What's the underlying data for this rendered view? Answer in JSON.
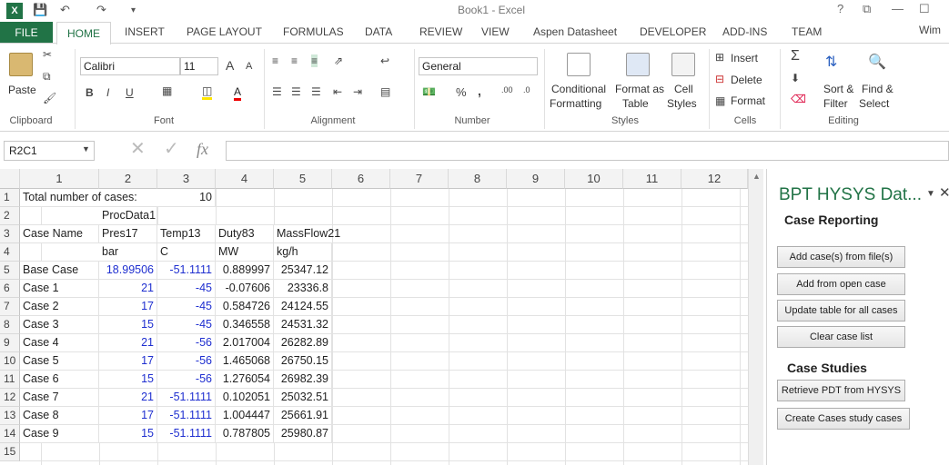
{
  "titlebar": {
    "title": "Book1 - Excel",
    "help": "?",
    "restore": "⧉",
    "minimize": "—",
    "maximize": "☐"
  },
  "tabs": {
    "file": "FILE",
    "home": "HOME",
    "items": [
      "INSERT",
      "PAGE LAYOUT",
      "FORMULAS",
      "DATA",
      "REVIEW",
      "VIEW",
      "Aspen Datasheet",
      "DEVELOPER",
      "ADD-INS",
      "TEAM"
    ],
    "user": "Wim"
  },
  "ribbon": {
    "clipboard": {
      "paste": "Paste",
      "label": "Clipboard"
    },
    "font": {
      "name": "Calibri",
      "size": "11",
      "bold": "B",
      "italic": "I",
      "underline": "U",
      "grow": "A",
      "shrink": "A",
      "color": "A",
      "label": "Font"
    },
    "alignment": {
      "label": "Alignment"
    },
    "number": {
      "format": "General",
      "percent": "%",
      "comma": ",",
      "label": "Number"
    },
    "styles": {
      "conditional": "Conditional",
      "conditional2": "Formatting",
      "table": "Format as",
      "table2": "Table",
      "cell": "Cell",
      "cell2": "Styles",
      "label": "Styles"
    },
    "cells": {
      "insert": "Insert",
      "delete": "Delete",
      "format": "Format",
      "label": "Cells"
    },
    "editing": {
      "sort": "Sort &",
      "sort2": "Filter",
      "find": "Find &",
      "find2": "Select",
      "label": "Editing"
    }
  },
  "formula_bar": {
    "name_box": "R2C1",
    "fx": "fx",
    "value": ""
  },
  "grid": {
    "columns": [
      "1",
      "2",
      "3",
      "4",
      "5",
      "6",
      "7",
      "8",
      "9",
      "10",
      "11",
      "12"
    ],
    "rows": [
      "1",
      "2",
      "3",
      "4",
      "5",
      "6",
      "7",
      "8",
      "9",
      "10",
      "11",
      "12",
      "13",
      "14",
      "15"
    ],
    "r1": {
      "label": "Total number of cases:",
      "value": "10"
    },
    "r2": {
      "procdata": "ProcData1"
    },
    "r3": [
      "Case Name",
      "Pres17",
      "Temp13",
      "Duty83",
      "MassFlow21"
    ],
    "r4": [
      "",
      "bar",
      "C",
      "MW",
      "kg/h"
    ],
    "data": [
      [
        "Base Case",
        "18.99506",
        "-51.1111",
        "0.889997",
        "25347.12"
      ],
      [
        "Case 1",
        "21",
        "-45",
        "-0.07606",
        "23336.8"
      ],
      [
        "Case 2",
        "17",
        "-45",
        "0.584726",
        "24124.55"
      ],
      [
        "Case 3",
        "15",
        "-45",
        "0.346558",
        "24531.32"
      ],
      [
        "Case 4",
        "21",
        "-56",
        "2.017004",
        "26282.89"
      ],
      [
        "Case 5",
        "17",
        "-56",
        "1.465068",
        "26750.15"
      ],
      [
        "Case 6",
        "15",
        "-56",
        "1.276054",
        "26982.39"
      ],
      [
        "Case 7",
        "21",
        "-51.1111",
        "0.102051",
        "25032.51"
      ],
      [
        "Case 8",
        "17",
        "-51.1111",
        "1.004447",
        "25661.91"
      ],
      [
        "Case 9",
        "15",
        "-51.1111",
        "0.787805",
        "25980.87"
      ]
    ]
  },
  "task_pane": {
    "title": "BPT HYSYS Dat...",
    "case_reporting": "Case Reporting",
    "buttons_reporting": [
      "Add case(s) from file(s)",
      "Add from open case",
      "Update table for all cases",
      "Clear case list"
    ],
    "case_studies": "Case Studies",
    "buttons_studies": [
      "Retrieve PDT from HYSYS",
      "Create Cases study cases"
    ]
  },
  "colors": {
    "accent": "#217346",
    "input_blue": "#1f2fd0"
  }
}
